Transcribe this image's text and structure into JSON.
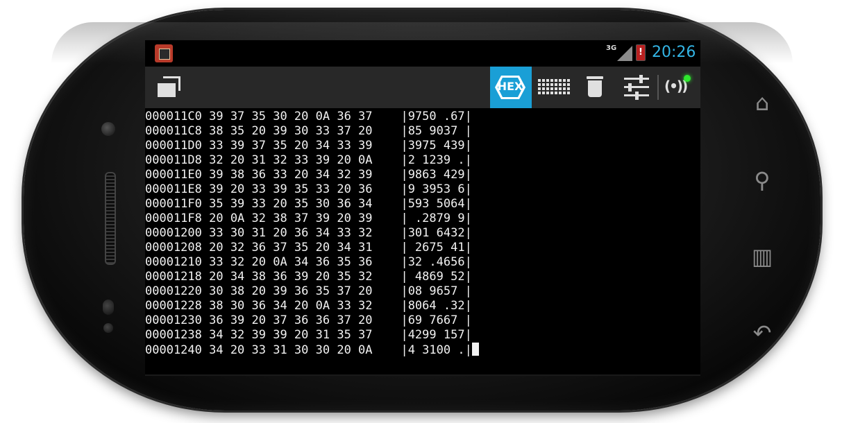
{
  "status_bar": {
    "network": "3G",
    "battery_text": "!",
    "time": "20:26",
    "time_color": "#33b5e5"
  },
  "action_bar": {
    "hex_label": "HEX",
    "hex_active_color": "#1a9fd6",
    "connection_text": "(•))",
    "connection_status_color": "#2ee82e"
  },
  "terminal": {
    "lines": [
      "000011C0 39 37 35 30 20 0A 36 37    |9750 .67|",
      "000011C8 38 35 20 39 30 33 37 20    |85 9037 |",
      "000011D0 33 39 37 35 20 34 33 39    |3975 439|",
      "000011D8 32 20 31 32 33 39 20 0A    |2 1239 .|",
      "000011E0 39 38 36 33 20 34 32 39    |9863 429|",
      "000011E8 39 20 33 39 35 33 20 36    |9 3953 6|",
      "000011F0 35 39 33 20 35 30 36 34    |593 5064|",
      "000011F8 20 0A 32 38 37 39 20 39    | .2879 9|",
      "00001200 33 30 31 20 36 34 33 32    |301 6432|",
      "00001208 20 32 36 37 35 20 34 31    | 2675 41|",
      "00001210 33 32 20 0A 34 36 35 36    |32 .4656|",
      "00001218 20 34 38 36 39 20 35 32    | 4869 52|",
      "00001220 30 38 20 39 36 35 37 20    |08 9657 |",
      "00001228 38 30 36 34 20 0A 33 32    |8064 .32|",
      "00001230 36 39 20 37 36 36 37 20    |69 7667 |",
      "00001238 34 32 39 39 20 31 35 37    |4299 157|",
      "00001240 34 20 33 31 30 30 20 0A    |4 3100 .|"
    ]
  }
}
